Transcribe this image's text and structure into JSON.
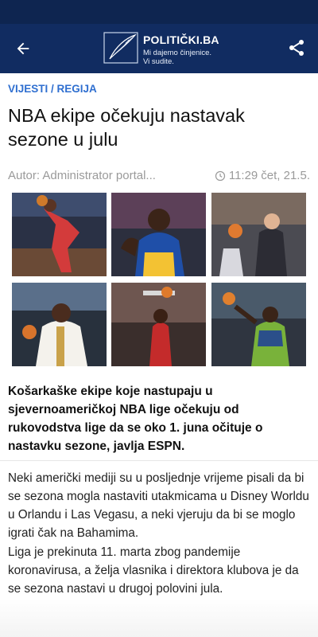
{
  "header": {
    "brand": "POLITIČKI.BA",
    "tagline_line1": "Mi dajemo činjenice.",
    "tagline_line2": "Vi sudite.",
    "back_icon": "arrow-left-icon",
    "share_icon": "share-icon",
    "bar_color": "#112c61"
  },
  "article": {
    "category": "VIJESTI / REGIJA",
    "title": "NBA ekipe očekuju nastavak sezone u julu",
    "author": "Autor: Administrator portal...",
    "time": "11:29",
    "date": "čet, 21.5.",
    "photos": [
      {
        "icon": "basketball-photo-1"
      },
      {
        "icon": "basketball-photo-2"
      },
      {
        "icon": "basketball-photo-3"
      },
      {
        "icon": "basketball-photo-4"
      },
      {
        "icon": "basketball-photo-5"
      },
      {
        "icon": "basketball-photo-6"
      }
    ],
    "lead": "Košarkaške ekipe koje nastupaju u sjevernoameričkoj NBA lige očekuju od rukovodstva lige da se oko 1. juna očituje o nastavku sezone, javlja ESPN.",
    "paragraphs": [
      "Neki američki mediji su u posljednje vrijeme pisali da bi se sezona mogla nastaviti utakmicama u Disney Worldu u Orlandu i Las Vegasu, a neki vjeruju da bi se moglo igrati čak na Bahamima.",
      "Liga je prekinuta 11. marta zbog pandemije koronavirusa, a želja vlasnika i direktora klubova je da se sezona nastavi u drugoj polovini jula."
    ],
    "category_color": "#2f6fd0"
  }
}
